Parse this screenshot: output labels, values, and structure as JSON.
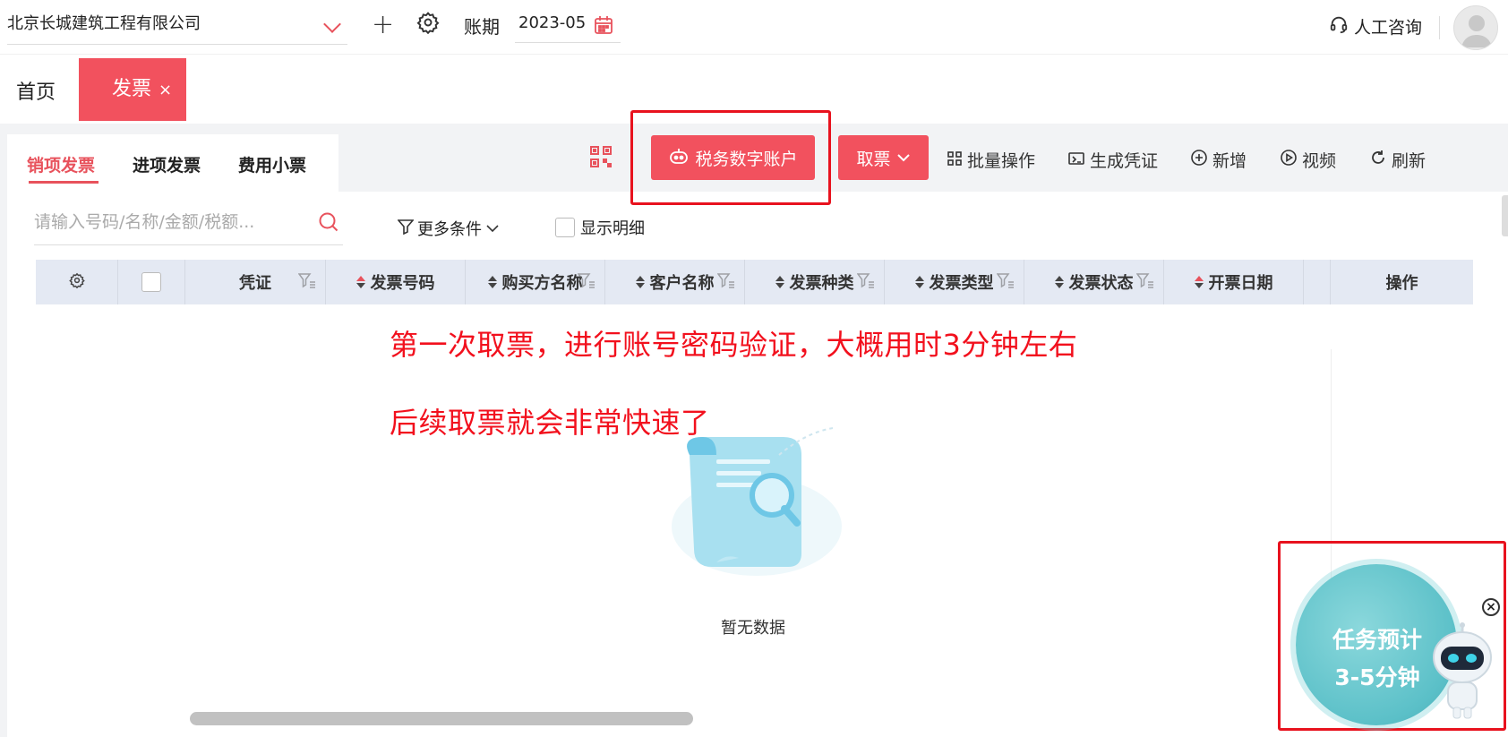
{
  "header": {
    "company": "北京长城建筑工程有限公司",
    "period_label": "账期",
    "period_value": "2023-05",
    "support_label": "人工咨询"
  },
  "tabs": {
    "home": "首页",
    "active": "发票",
    "close": "×"
  },
  "subtabs": [
    {
      "label": "销项发票",
      "active": true
    },
    {
      "label": "进项发票",
      "active": false
    },
    {
      "label": "费用小票",
      "active": false
    }
  ],
  "toolbar": {
    "digital_account": "税务数字账户",
    "take_invoice": "取票",
    "batch": "批量操作",
    "voucher": "生成凭证",
    "add": "新增",
    "video": "视频",
    "refresh": "刷新"
  },
  "search": {
    "placeholder": "请输入号码/名称/金额/税额..."
  },
  "filters": {
    "more": "更多条件",
    "show_detail": "显示明细"
  },
  "table": {
    "columns": [
      "凭证",
      "发票号码",
      "购买方名称",
      "客户名称",
      "发票种类",
      "发票类型",
      "发票状态",
      "开票日期",
      "操作"
    ]
  },
  "annotations": {
    "line1": "第一次取票，进行账号密码验证，大概用时3分钟左右",
    "line2": "后续取票就会非常快速了"
  },
  "empty": {
    "text": "暂无数据"
  },
  "task_widget": {
    "line1": "任务预计",
    "line2": "3-5分钟"
  },
  "colors": {
    "brand_red": "#f2515e",
    "annotation_red": "#f2101d",
    "header_bg": "#e4e9f3"
  }
}
